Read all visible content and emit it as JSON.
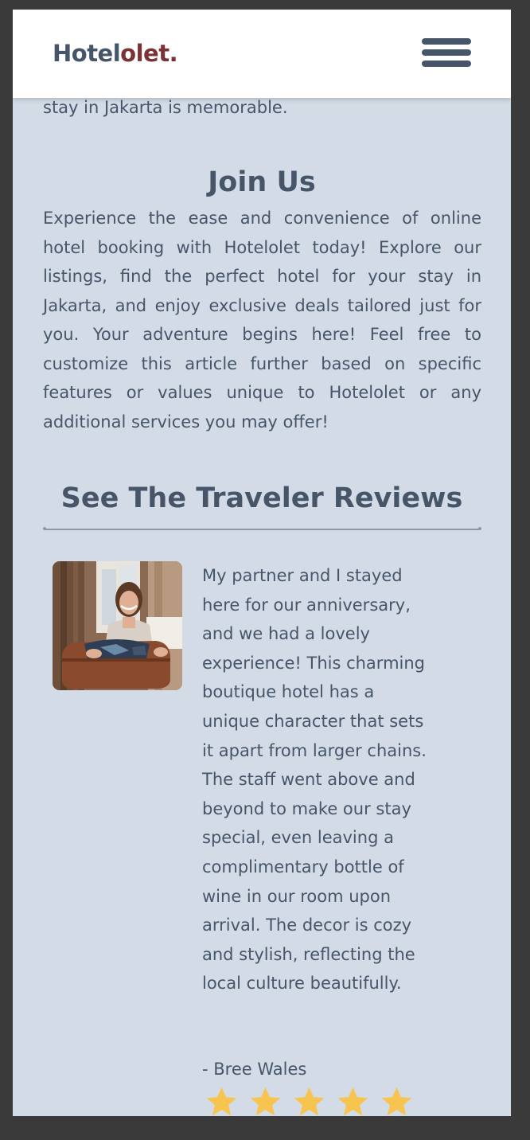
{
  "navbar": {
    "logo_primary": "Hotel",
    "logo_accent": "olet.",
    "menu_icon": "hamburger-menu-icon"
  },
  "intro": {
    "tail_text": "stay in Jakarta is memorable."
  },
  "join": {
    "title": "Join Us",
    "body": "Experience the ease and convenience of online hotel booking with Hotelolet today! Explore our listings, find the perfect hotel for your stay in Jakarta, and enjoy exclusive deals tailored just for you. Your adventure begins here! Feel free to customize this article further based on specific features or values unique to Hotelolet or any additional services you may offer!"
  },
  "reviews": {
    "title": "See The Traveler Reviews",
    "items": [
      {
        "text": "My partner and I stayed here for our anniversary, and we had a lovely experience! This charming boutique hotel has a unique character that sets it apart from larger chains. The staff went above and beyond to make our stay special, even leaving a complimentary bottle of wine in our room upon arrival. The decor is cozy and stylish, reflecting the local culture beautifully.",
        "author": "- Bree Wales",
        "rating": 5,
        "photo_icon": "reviewer-photo"
      }
    ]
  },
  "colors": {
    "background": "#d3dce6",
    "text": "#475569",
    "logo_accent": "#7b3236",
    "star": "#f6c44f"
  }
}
